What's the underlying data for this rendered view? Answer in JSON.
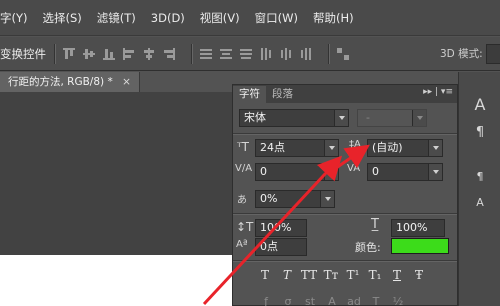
{
  "menubar": {
    "items": [
      "字(Y)",
      "选择(S)",
      "滤镜(T)",
      "3D(D)",
      "视图(V)",
      "窗口(W)",
      "帮助(H)"
    ]
  },
  "optbar": {
    "transform_label": "变换控件",
    "mode_label": "3D 模式:"
  },
  "document": {
    "tab_title": "行距的方法, RGB/8) *",
    "close_glyph": "×"
  },
  "character_panel": {
    "tabs": [
      "字符",
      "段落"
    ],
    "menu_glyph": "▸▸ | ▾≡",
    "font_family": "宋体",
    "font_style": "-",
    "font_size": "24点",
    "leading": "(自动)",
    "kerning": "0",
    "tracking": "0",
    "tsume": "0%",
    "vertical_scale": "100%",
    "horizontal_scale": "100%",
    "baseline_shift": "0点",
    "color_label": "颜色:",
    "color_value": "#3cdc1a",
    "style_buttons": [
      "T",
      "T",
      "TT",
      "Tт",
      "T¹",
      "T₁",
      "T",
      "Ŧ"
    ]
  },
  "dock": {
    "items": [
      "A",
      "¶",
      "¶",
      "A"
    ]
  },
  "annotation": {
    "arrow_color": "#e8232a"
  }
}
